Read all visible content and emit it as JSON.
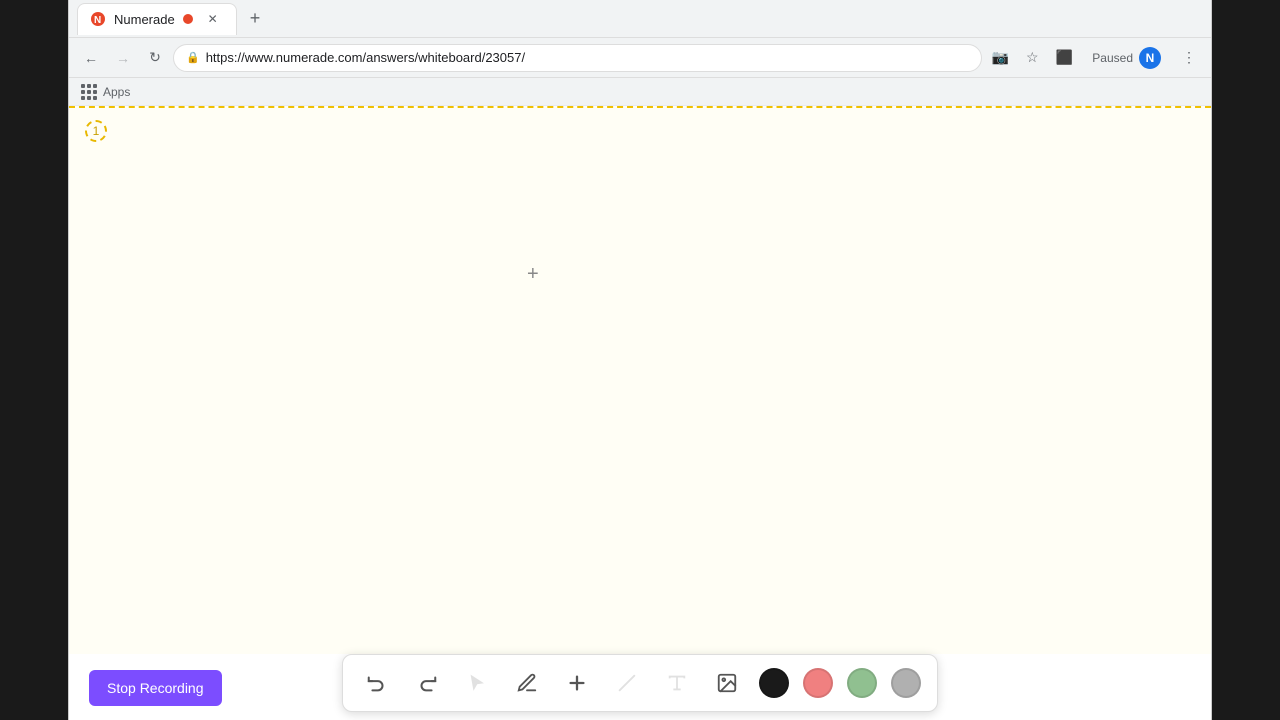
{
  "browser": {
    "tab": {
      "favicon_label": "N",
      "title": "Numerade",
      "url": "https://www.numerade.com/answers/whiteboard/23057/"
    },
    "nav": {
      "back_disabled": false,
      "forward_disabled": true,
      "address": "https://www.numerade.com/answers/whiteboard/23057/"
    },
    "paused_label": "Paused",
    "profile_initial": "N",
    "apps_label": "Apps"
  },
  "whiteboard": {
    "page_number": "1",
    "background_color": "#fffef5",
    "border_color": "#f0d060"
  },
  "toolbar": {
    "stop_recording_label": "Stop Recording",
    "tools": [
      {
        "name": "undo",
        "icon": "↩",
        "label": "Undo",
        "disabled": false
      },
      {
        "name": "redo",
        "icon": "↪",
        "label": "Redo",
        "disabled": false
      },
      {
        "name": "select",
        "icon": "▲",
        "label": "Select",
        "disabled": false
      },
      {
        "name": "pen",
        "icon": "✏",
        "label": "Pen",
        "disabled": false
      },
      {
        "name": "add",
        "icon": "+",
        "label": "Add",
        "disabled": false
      },
      {
        "name": "eraser",
        "icon": "/",
        "label": "Eraser",
        "disabled": false
      },
      {
        "name": "text",
        "icon": "A",
        "label": "Text",
        "disabled": false
      },
      {
        "name": "image",
        "icon": "🖼",
        "label": "Image",
        "disabled": false
      }
    ],
    "colors": [
      {
        "name": "black",
        "hex": "#1a1a1a"
      },
      {
        "name": "pink",
        "hex": "#f08080"
      },
      {
        "name": "green",
        "hex": "#90c090"
      },
      {
        "name": "gray",
        "hex": "#b0b0b0"
      }
    ]
  }
}
